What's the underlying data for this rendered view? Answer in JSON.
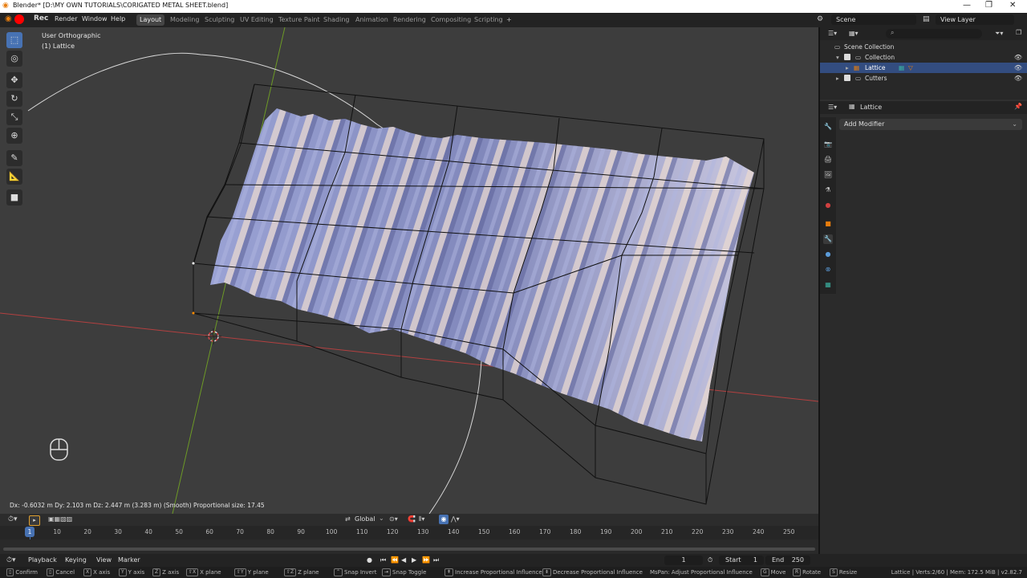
{
  "title": "Blender* [D:\\MY OWN TUTORIALS\\CORIGATED METAL SHEET.blend]",
  "menus": [
    "Rec",
    "Render",
    "Window",
    "Help"
  ],
  "workspaces": [
    "Layout",
    "Modeling",
    "Sculpting",
    "UV Editing",
    "Texture Paint",
    "Shading",
    "Animation",
    "Rendering",
    "Compositing",
    "Scripting"
  ],
  "scene": "Scene",
  "view_layer": "View Layer",
  "viewport": {
    "view_name": "User Orthographic",
    "object_name": "(1) Lattice",
    "transform_status": "Dx: -0.6032 m  Dy: 2.103 m  Dz: 2.447 m (3.283 m) (Smooth)   Proportional size: 17.45",
    "orientation": "Global"
  },
  "outliner": {
    "rows": [
      {
        "label": "Scene Collection",
        "indent": 0
      },
      {
        "label": "Collection",
        "indent": 1
      },
      {
        "label": "Lattice",
        "indent": 2
      },
      {
        "label": "Cutters",
        "indent": 1
      }
    ]
  },
  "properties": {
    "object": "Lattice",
    "add_modifier": "Add Modifier"
  },
  "timeline": {
    "ticks": [
      "10",
      "20",
      "30",
      "40",
      "50",
      "60",
      "70",
      "80",
      "90",
      "100",
      "110",
      "120",
      "130",
      "140",
      "150",
      "160",
      "170",
      "180",
      "190",
      "200",
      "210",
      "220",
      "230",
      "240",
      "250"
    ],
    "current_frame": "1",
    "menus": [
      "Playback",
      "Keying",
      "View",
      "Marker"
    ],
    "frame": "1",
    "start_label": "Start",
    "start": "1",
    "end_label": "End",
    "end": "250"
  },
  "statusbar": {
    "items": [
      "Confirm",
      "Cancel",
      "X axis",
      "Y axis",
      "Z axis",
      "X plane",
      "Y plane",
      "Z plane",
      "Snap Invert",
      "Snap Toggle",
      "Increase Proportional Influence",
      "Decrease Proportional Influence",
      "MsPan: Adjust Proportional Influence",
      "Move",
      "Rotate",
      "Resize"
    ],
    "stats": "Lattice | Verts:2/60 | Mem: 172.5 MiB | v2.82.7"
  },
  "colors": {
    "accent": "#4772b3",
    "x_axis": "#b34040",
    "y_axis": "#6d9a26",
    "sheet": "#8d95c4"
  }
}
